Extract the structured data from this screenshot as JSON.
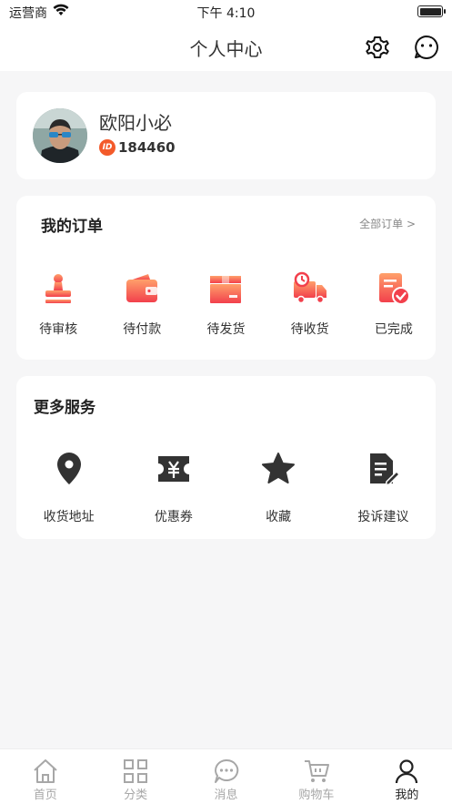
{
  "status_bar": {
    "carrier": "运营商",
    "time": "下午 4:10"
  },
  "nav": {
    "title": "个人中心",
    "settings_icon": "gear-icon",
    "message_icon": "chat-face-icon"
  },
  "profile": {
    "name": "欧阳小必",
    "id_badge": "ID",
    "id": "184460"
  },
  "orders": {
    "title": "我的订单",
    "all_label": "全部订单 >",
    "items": [
      {
        "label": "待审核",
        "icon": "stamp-icon"
      },
      {
        "label": "待付款",
        "icon": "wallet-icon"
      },
      {
        "label": "待发货",
        "icon": "box-icon"
      },
      {
        "label": "待收货",
        "icon": "delivery-truck-icon"
      },
      {
        "label": "已完成",
        "icon": "check-document-icon"
      }
    ],
    "accent_gradient": [
      "#ff9966",
      "#f23d4c"
    ]
  },
  "services": {
    "title": "更多服务",
    "items": [
      {
        "label": "收货地址",
        "icon": "location-pin-icon"
      },
      {
        "label": "优惠券",
        "icon": "coupon-icon"
      },
      {
        "label": "收藏",
        "icon": "star-icon"
      },
      {
        "label": "投诉建议",
        "icon": "edit-document-icon"
      }
    ]
  },
  "tabs": [
    {
      "label": "首页",
      "icon": "home-icon",
      "active": false
    },
    {
      "label": "分类",
      "icon": "grid-icon",
      "active": false
    },
    {
      "label": "消息",
      "icon": "chat-bubble-icon",
      "active": false
    },
    {
      "label": "购物车",
      "icon": "cart-icon",
      "active": false
    },
    {
      "label": "我的",
      "icon": "user-icon",
      "active": true
    }
  ]
}
